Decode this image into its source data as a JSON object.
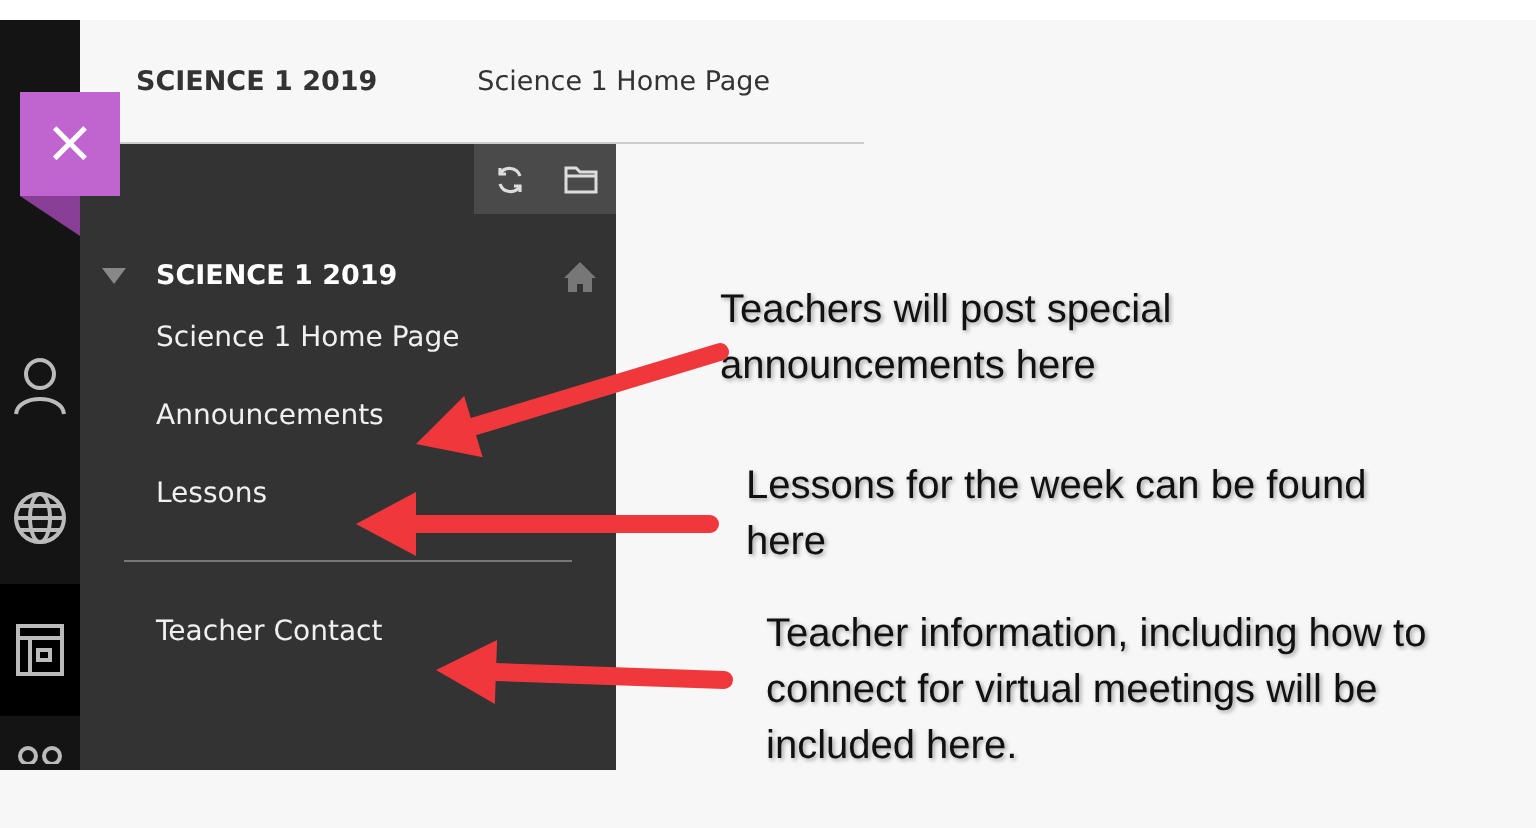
{
  "breadcrumb": {
    "course": "SCIENCE 1 2019",
    "page": "Science 1 Home Page"
  },
  "close_button": {
    "label": "×"
  },
  "course_menu": {
    "title": "SCIENCE 1 2019",
    "expanded": true,
    "items": [
      {
        "label": "Science 1 Home Page",
        "kind": "link"
      },
      {
        "label": "Announcements",
        "kind": "link"
      },
      {
        "label": "Lessons",
        "kind": "link"
      },
      {
        "kind": "divider"
      },
      {
        "label": "Teacher Contact",
        "kind": "link"
      }
    ]
  },
  "annotations": [
    {
      "text": "Teachers will post special announcements here"
    },
    {
      "text": "Lessons for the week can be found here"
    },
    {
      "text": "Teacher information, including how to connect for virtual meetings will be included here."
    }
  ]
}
